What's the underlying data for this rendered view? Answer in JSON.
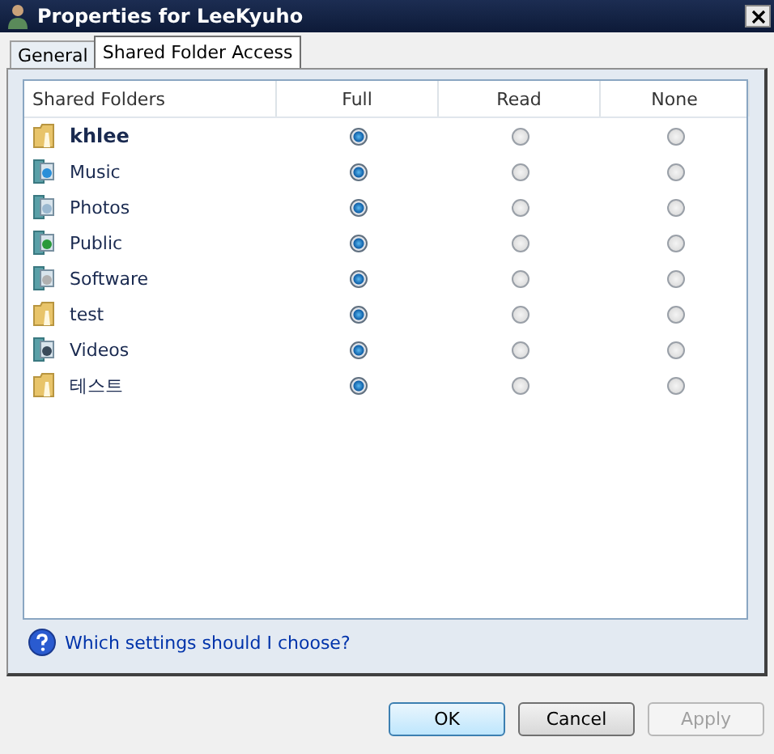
{
  "window": {
    "title": "Properties for LeeKyuho"
  },
  "tabs": [
    {
      "label": "General",
      "selected": false
    },
    {
      "label": "Shared Folder Access",
      "selected": true
    }
  ],
  "table": {
    "columns": [
      "Shared Folders",
      "Full",
      "Read",
      "None"
    ],
    "rows": [
      {
        "name": "khlee",
        "kind": "folder",
        "bold": true,
        "options": [
          {
            "selected": true
          },
          {
            "selected": false
          },
          {
            "selected": false
          }
        ]
      },
      {
        "name": "Music",
        "kind": "music",
        "bold": false,
        "options": [
          {
            "selected": true
          },
          {
            "selected": false
          },
          {
            "selected": false
          }
        ]
      },
      {
        "name": "Photos",
        "kind": "photos",
        "bold": false,
        "options": [
          {
            "selected": true
          },
          {
            "selected": false
          },
          {
            "selected": false
          }
        ]
      },
      {
        "name": "Public",
        "kind": "public",
        "bold": false,
        "options": [
          {
            "selected": true
          },
          {
            "selected": false
          },
          {
            "selected": false
          }
        ]
      },
      {
        "name": "Software",
        "kind": "software",
        "bold": false,
        "options": [
          {
            "selected": true
          },
          {
            "selected": false
          },
          {
            "selected": false
          }
        ]
      },
      {
        "name": "test",
        "kind": "folder",
        "bold": false,
        "options": [
          {
            "selected": true
          },
          {
            "selected": false
          },
          {
            "selected": false
          }
        ]
      },
      {
        "name": "Videos",
        "kind": "videos",
        "bold": false,
        "options": [
          {
            "selected": true
          },
          {
            "selected": false
          },
          {
            "selected": false
          }
        ]
      },
      {
        "name": "테스트",
        "kind": "folder",
        "bold": false,
        "options": [
          {
            "selected": true
          },
          {
            "selected": false
          },
          {
            "selected": false
          }
        ]
      }
    ]
  },
  "help_link": "Which settings should I choose?",
  "buttons": [
    {
      "label": "OK",
      "default": true,
      "disabled": false
    },
    {
      "label": "Cancel",
      "default": false,
      "disabled": false
    },
    {
      "label": "Apply",
      "default": false,
      "disabled": true
    }
  ]
}
